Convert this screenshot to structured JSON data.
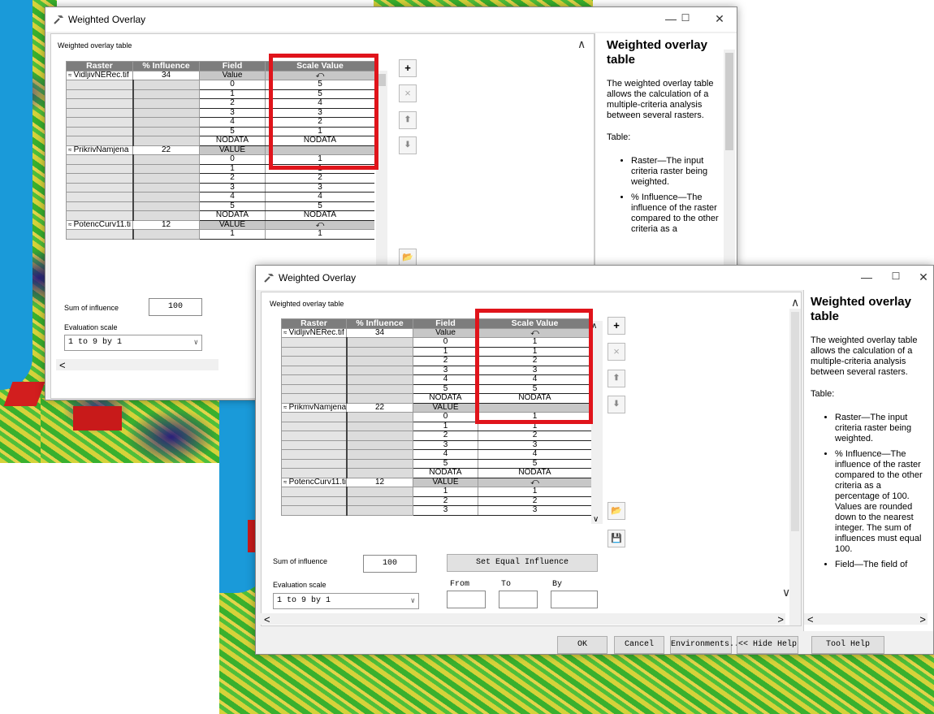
{
  "window_title": "Weighted Overlay",
  "section_label": "Weighted overlay table",
  "columns": [
    "Raster",
    "% Influence",
    "Field",
    "Scale Value"
  ],
  "undo_glyph": "⤺",
  "top": {
    "groups": [
      {
        "raster": "VidljivNERec.tif",
        "influence": "34",
        "field": "Value",
        "scale": "⤺",
        "rows": [
          [
            "0",
            "5"
          ],
          [
            "1",
            "5"
          ],
          [
            "2",
            "4"
          ],
          [
            "3",
            "3"
          ],
          [
            "4",
            "2"
          ],
          [
            "5",
            "1"
          ],
          [
            "NODATA",
            "NODATA"
          ]
        ]
      },
      {
        "raster": "PrikrivNamjena",
        "influence": "22",
        "field": "VALUE",
        "scale": "",
        "rows": [
          [
            "0",
            "1"
          ],
          [
            "1",
            "1"
          ],
          [
            "2",
            "2"
          ],
          [
            "3",
            "3"
          ],
          [
            "4",
            "4"
          ],
          [
            "5",
            "5"
          ],
          [
            "NODATA",
            "NODATA"
          ]
        ]
      },
      {
        "raster": "PotencCurv11.ti",
        "influence": "12",
        "field": "VALUE",
        "scale": "⤺",
        "rows": [
          [
            "1",
            "1"
          ]
        ]
      }
    ],
    "sum_label": "Sum of influence",
    "sum_value": "100",
    "eval_label": "Evaluation scale",
    "eval_value": "1 to 9 by 1"
  },
  "bottom": {
    "groups": [
      {
        "raster": "VidljivNERec.tif",
        "influence": "34",
        "field": "Value",
        "scale": "⤺",
        "rows": [
          [
            "0",
            "1"
          ],
          [
            "1",
            "1"
          ],
          [
            "2",
            "2"
          ],
          [
            "3",
            "3"
          ],
          [
            "4",
            "4"
          ],
          [
            "5",
            "5"
          ],
          [
            "NODATA",
            "NODATA"
          ]
        ]
      },
      {
        "raster": "PrikmvNamjena",
        "influence": "22",
        "field": "VALUE",
        "scale": "",
        "rows": [
          [
            "0",
            "1"
          ],
          [
            "1",
            "1"
          ],
          [
            "2",
            "2"
          ],
          [
            "3",
            "3"
          ],
          [
            "4",
            "4"
          ],
          [
            "5",
            "5"
          ],
          [
            "NODATA",
            "NODATA"
          ]
        ]
      },
      {
        "raster": "PotencCurv11.ti",
        "influence": "12",
        "field": "VALUE",
        "scale": "⤺",
        "rows": [
          [
            "1",
            "1"
          ],
          [
            "2",
            "2"
          ],
          [
            "3",
            "3"
          ]
        ]
      }
    ],
    "sum_label": "Sum of influence",
    "sum_value": "100",
    "set_equal": "Set Equal Influence",
    "eval_label": "Evaluation scale",
    "eval_value": "1 to 9 by 1",
    "from_label": "From",
    "to_label": "To",
    "by_label": "By",
    "buttons": {
      "ok": "OK",
      "cancel": "Cancel",
      "env": "Environments...",
      "hide_help": "<< Hide Help",
      "tool_help": "Tool Help"
    }
  },
  "help": {
    "title": "Weighted overlay table",
    "intro": "The weighted overlay table allows the calculation of a multiple-criteria analysis between several rasters.",
    "table_label": "Table:",
    "bullets_top": [
      "Raster—The input criteria raster being weighted.",
      "% Influence—The influence of the raster compared to the other criteria as a"
    ],
    "bullets_bottom": [
      "Raster—The input criteria raster being weighted.",
      "% Influence—The influence of the raster compared to the other criteria as a percentage of 100. Values are rounded down to the nearest integer. The sum of influences must equal 100.",
      "Field—The field of"
    ]
  },
  "window_controls": {
    "minimize": "—",
    "maximize": "☐",
    "close": "✕"
  },
  "colors": {
    "highlight_box": "#e0141b",
    "header_bg": "#7d7d7d",
    "water": "#1a9ad9"
  },
  "icons": [
    "hammer-icon",
    "add-icon",
    "remove-icon",
    "move-up-icon",
    "move-down-icon",
    "open-folder-icon",
    "save-icon"
  ]
}
